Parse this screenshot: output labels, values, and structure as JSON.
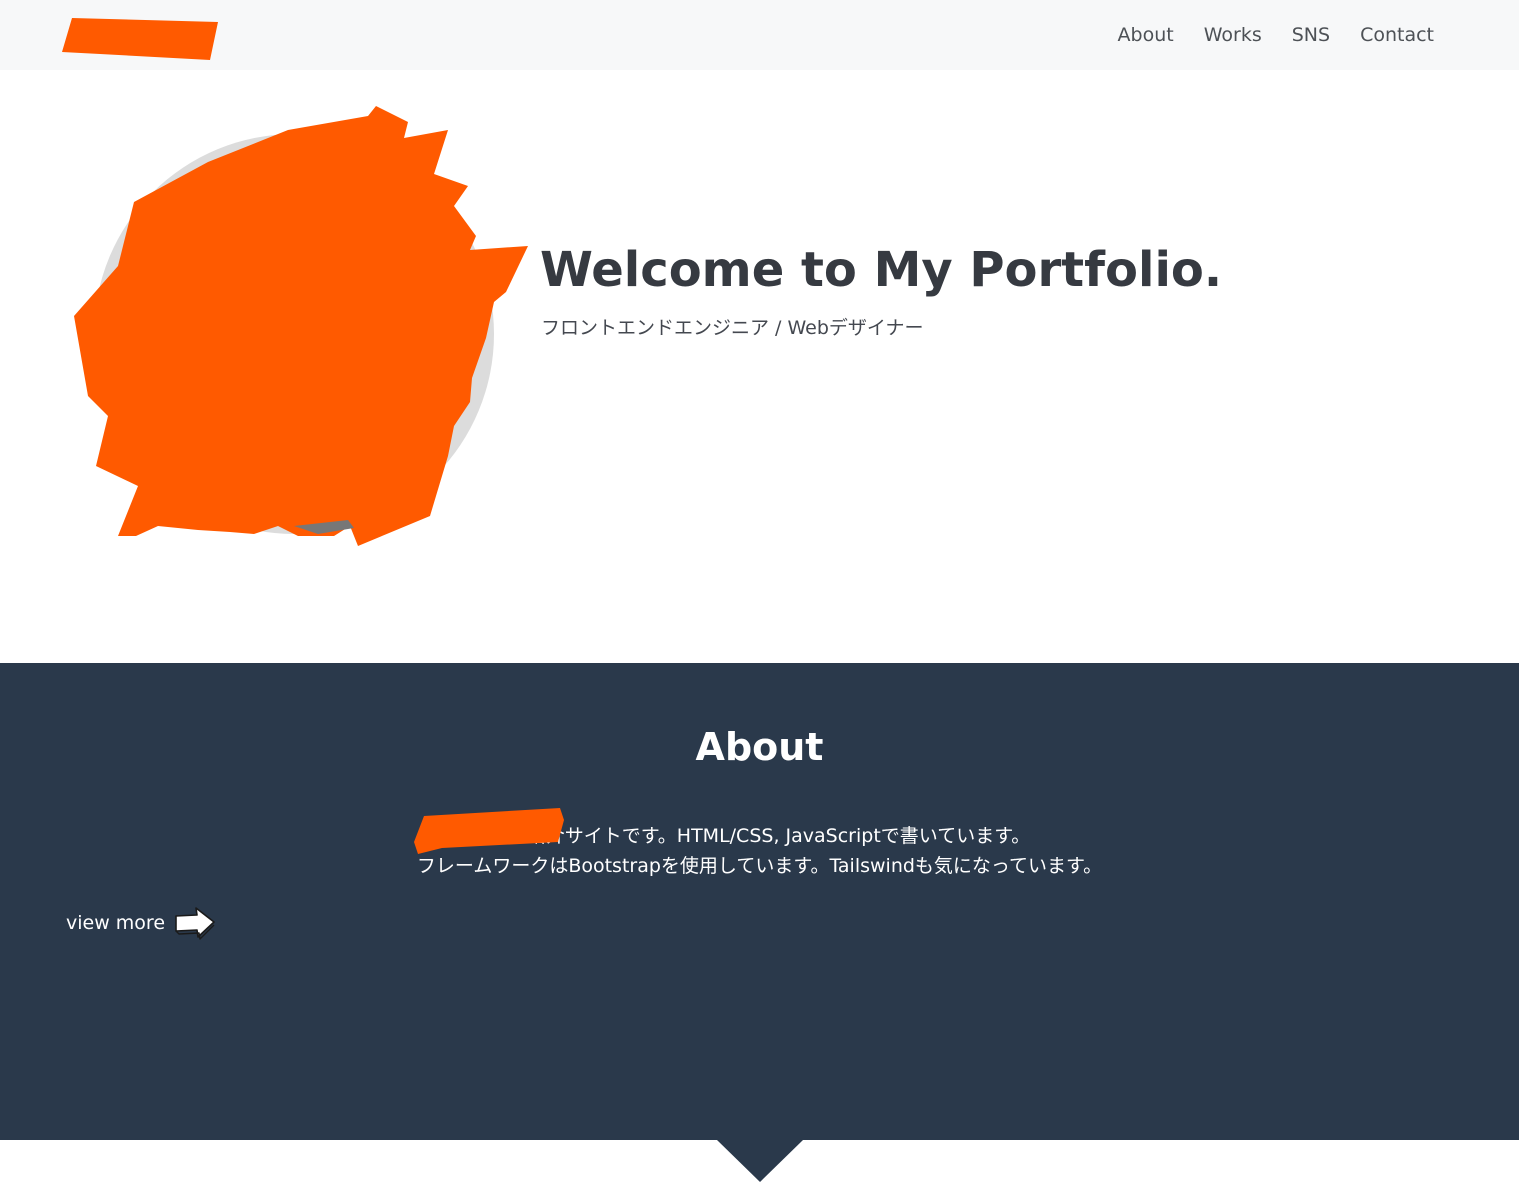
{
  "navbar": {
    "links": [
      {
        "label": "About"
      },
      {
        "label": "Works"
      },
      {
        "label": "SNS"
      },
      {
        "label": "Contact"
      }
    ]
  },
  "hero": {
    "title": "Welcome to My Portfolio.",
    "subtitle": "フロントエンドエンジニア / Webデザイナー"
  },
  "about": {
    "title": "About",
    "line1": "自己紹介サイトです。HTML/CSS, JavaScriptで書いています。",
    "line2": "フレームワークはBootstrapを使用しています。Tailswindも気になっています。",
    "view_more": "view more"
  },
  "colors": {
    "redaction": "#ff5a00",
    "navbar_bg": "#f7f8f9",
    "about_bg": "#2a394b"
  },
  "icons": {
    "view_more": "arrow-right-icon",
    "section_pointer": "triangle-down-icon"
  }
}
